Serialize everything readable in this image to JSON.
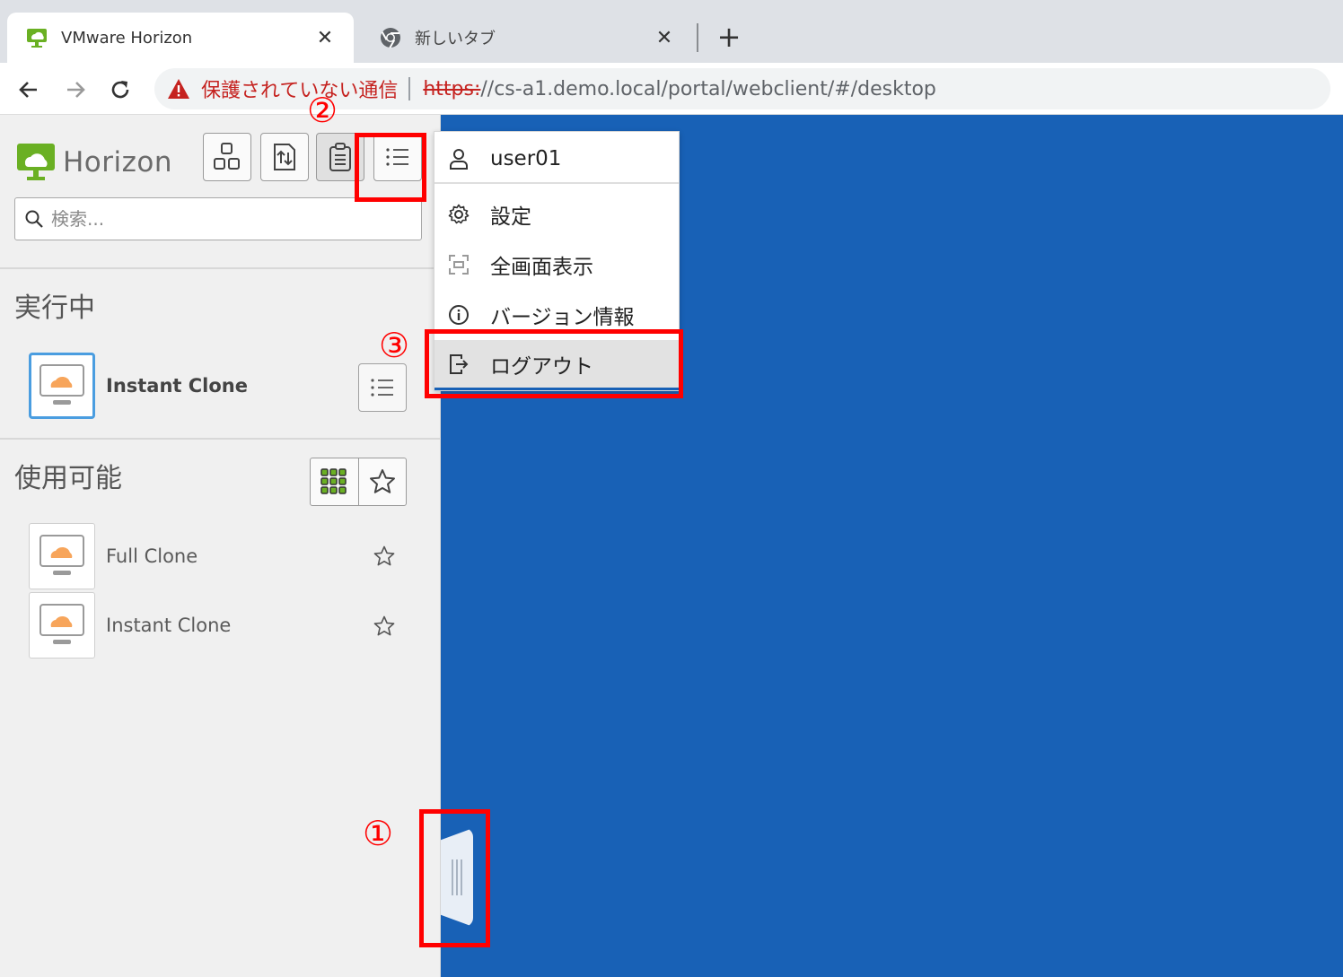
{
  "browser": {
    "tabs": [
      {
        "title": "VMware Horizon",
        "close": "✕",
        "active": true
      },
      {
        "title": "新しいタブ",
        "close": "✕",
        "active": false
      }
    ],
    "new_tab": "+",
    "security_label": "保護されていない通信",
    "url_scheme": "https:",
    "url_rest": "//cs-a1.demo.local/portal/webclient/#/desktop"
  },
  "sidebar": {
    "logo_text": "Horizon",
    "search_placeholder": "検索...",
    "running_title": "実行中",
    "running_items": [
      {
        "label": "Instant Clone"
      }
    ],
    "available_title": "使用可能",
    "available_items": [
      {
        "label": "Full Clone"
      },
      {
        "label": "Instant Clone"
      }
    ]
  },
  "menu": {
    "user": "user01",
    "settings": "設定",
    "fullscreen": "全画面表示",
    "about": "バージョン情報",
    "logout": "ログアウト"
  },
  "annotations": {
    "step1": "①",
    "step2": "②",
    "step3": "③"
  },
  "colors": {
    "desktop_bg": "#1861b6",
    "annotation": "#ff0000",
    "accent_green": "#6ab023",
    "cloud_orange": "#f7a55b"
  }
}
